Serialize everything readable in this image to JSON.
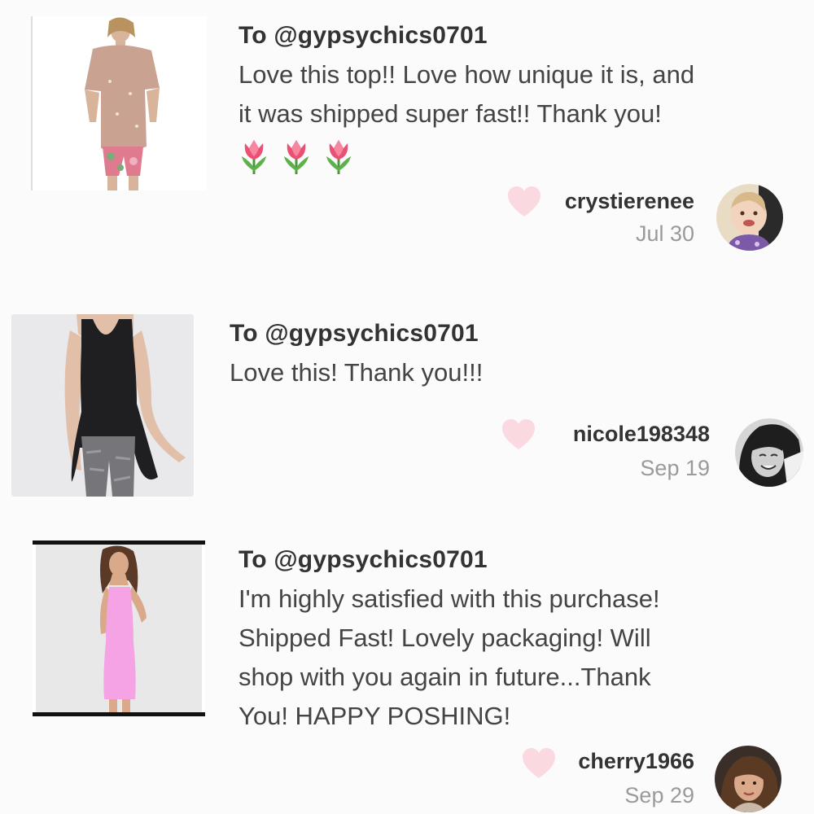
{
  "reviews": [
    {
      "to": "To @gypsychics0701",
      "message_lines": [
        "Love this top!! Love how unique it is, and",
        "it was shipped super fast!! Thank you!"
      ],
      "emojis": [
        "tulip-icon",
        "tulip-icon",
        "tulip-icon"
      ],
      "username": "crystierenee",
      "date": "Jul 30",
      "thumb_icon": "product-photo-mauve-top",
      "avatar_icon": "toddler-avatar"
    },
    {
      "to": "To @gypsychics0701",
      "message_lines": [
        "Love this! Thank you!!!"
      ],
      "emojis": [],
      "username": "nicole198348",
      "date": "Sep 19",
      "thumb_icon": "product-photo-black-tank",
      "avatar_icon": "woman-avatar-bw"
    },
    {
      "to": "To @gypsychics0701",
      "message_lines": [
        "I'm highly satisfied with this purchase!",
        "Shipped Fast! Lovely packaging! Will",
        "shop with you again in future...Thank",
        "You! HAPPY POSHING!"
      ],
      "emojis": [],
      "username": "cherry1966",
      "date": "Sep 29",
      "thumb_icon": "product-photo-pink-dress",
      "avatar_icon": "woman-avatar-brunette"
    }
  ],
  "colors": {
    "background": "#fcfbfc",
    "heart": "#fbd9e0",
    "username": "#333333",
    "date": "#9a9a9a"
  }
}
